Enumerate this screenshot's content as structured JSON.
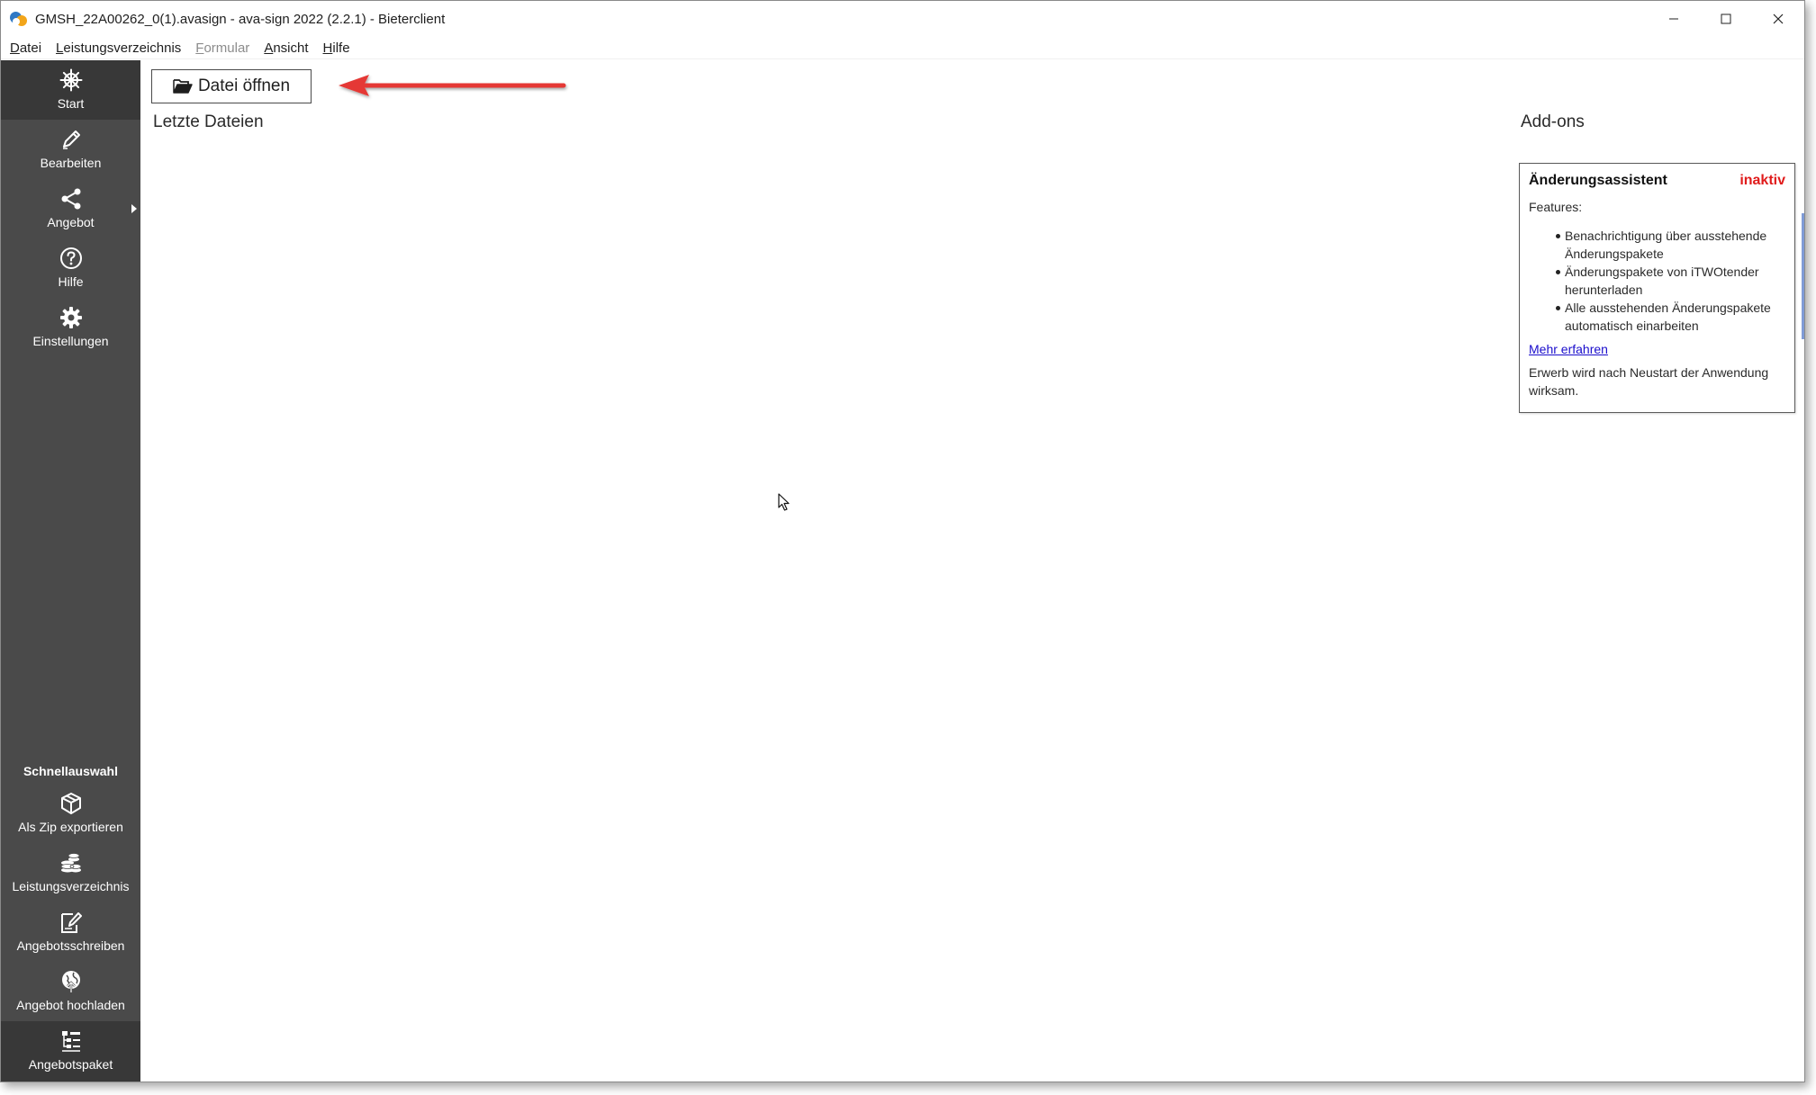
{
  "window": {
    "title": "GMSH_22A00262_0(1).avasign - ava-sign 2022 (2.2.1) - Bieterclient"
  },
  "menu": [
    "Datei",
    "Leistungsverzeichnis",
    "Formular",
    "Ansicht",
    "Hilfe"
  ],
  "sidebar": {
    "items": [
      {
        "label": "Start",
        "icon": "ship-wheel-icon",
        "active": true
      },
      {
        "label": "Bearbeiten",
        "icon": "pencil-icon"
      },
      {
        "label": "Angebot",
        "icon": "share-icon",
        "submenu": true
      },
      {
        "label": "Hilfe",
        "icon": "help-circle-icon"
      },
      {
        "label": "Einstellungen",
        "icon": "gear-icon"
      }
    ],
    "quick_title": "Schnellauswahl",
    "quick_items": [
      {
        "label": "Als Zip exportieren",
        "icon": "package-icon"
      },
      {
        "label": "Leistungsverzeichnis",
        "icon": "coins-stack-icon"
      },
      {
        "label": "Angebotsschreiben",
        "icon": "document-edit-icon"
      },
      {
        "label": "Angebot hochladen",
        "icon": "globe-upload-icon"
      },
      {
        "label": "Angebotspaket",
        "icon": "tree-list-icon",
        "active": true
      }
    ]
  },
  "main": {
    "open_button_label": "Datei öffnen",
    "recent_title": "Letzte Dateien",
    "addons_title": "Add-ons",
    "addon": {
      "name": "Änderungsassistent",
      "status": "inaktiv",
      "features_label": "Features:",
      "features": [
        "Benachrichtigung über ausstehende Änderungspakete",
        "Änderungspakete von iTWOtender herunterladen",
        "Alle ausstehenden Änderungspakete automatisch einarbeiten"
      ],
      "link": "Mehr erfahren",
      "note": "Erwerb wird nach Neustart der Anwendung wirksam."
    }
  },
  "colors": {
    "sidebar": "#4a4a4a",
    "sidebar_active": "#383838",
    "status_inactive": "#e01b1b",
    "link": "#1a0dcc",
    "annotation_arrow": "#e53935"
  }
}
